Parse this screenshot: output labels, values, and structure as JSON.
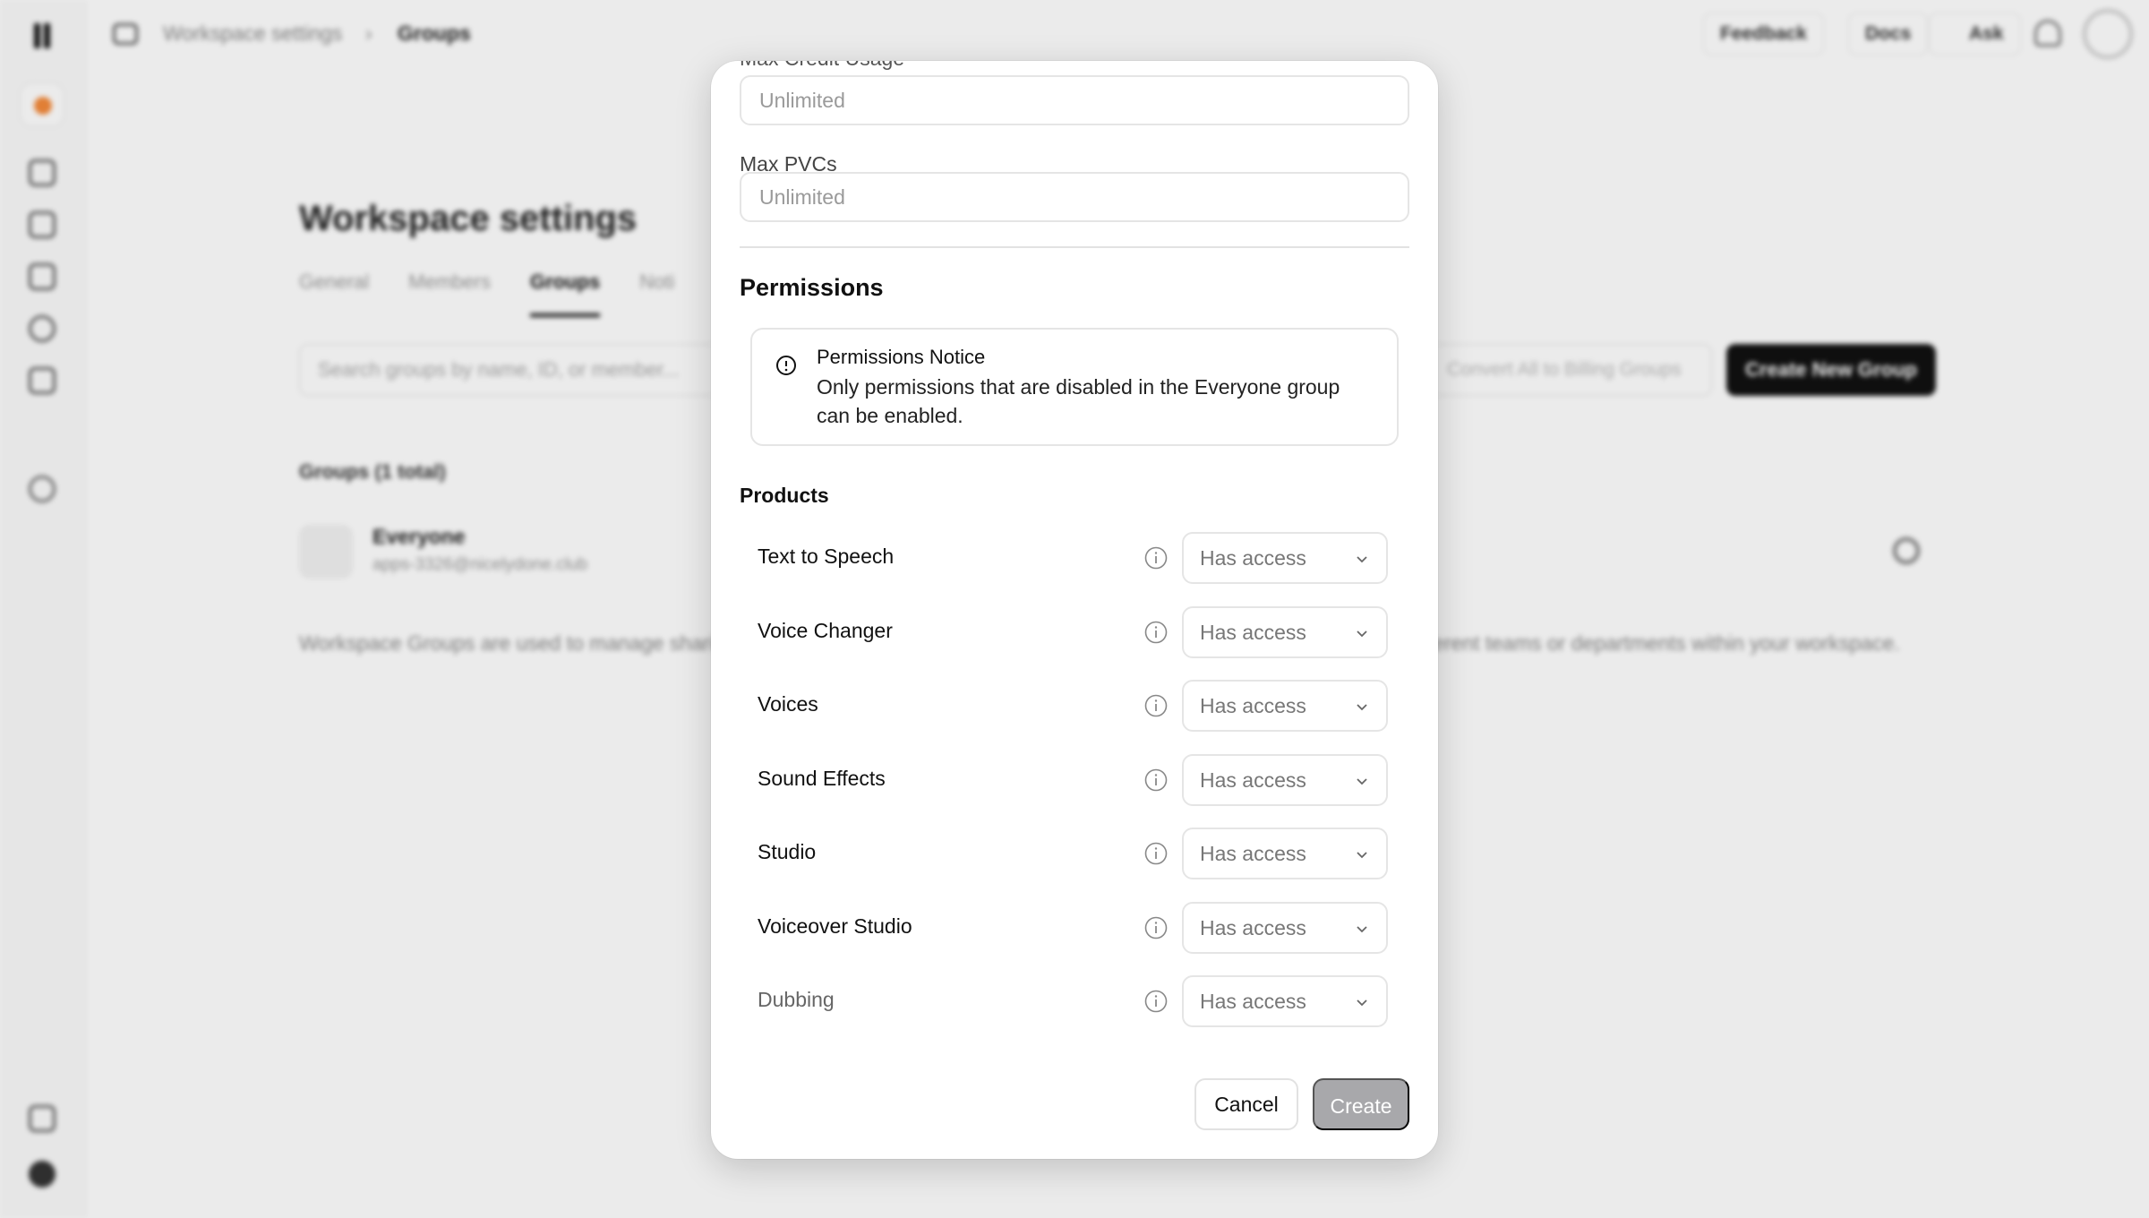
{
  "background": {
    "breadcrumb": {
      "parent": "Workspace settings",
      "separator": "›",
      "current": "Groups"
    },
    "topbar": {
      "feedback": "Feedback",
      "docs": "Docs",
      "ask": "Ask"
    },
    "page_title": "Workspace settings",
    "tabs": [
      {
        "label": "General"
      },
      {
        "label": "Members"
      },
      {
        "label": "Groups"
      },
      {
        "label": "Noti"
      }
    ],
    "search_placeholder": "Search groups by name, ID, or member...",
    "convert_label": "Convert All to Billing Groups",
    "create_group_label": "Create New Group",
    "groups_count": "Groups (1 total)",
    "group": {
      "name": "Everyone",
      "email": "apps-3326@nicelydone.club"
    },
    "description": "Workspace Groups are used to manage sharing and billing across your workspace. Use them to manage permissions for different teams or departments within your workspace."
  },
  "modal": {
    "max_credit_label": "Max Credit Usage",
    "max_credit_placeholder": "Unlimited",
    "max_pvcs_label": "Max PVCs",
    "max_pvcs_placeholder": "Unlimited",
    "permissions_heading": "Permissions",
    "notice": {
      "title": "Permissions Notice",
      "body": "Only permissions that are disabled in the Everyone group can be enabled."
    },
    "products_heading": "Products",
    "products": [
      {
        "name": "Text to Speech",
        "access": "Has access"
      },
      {
        "name": "Voice Changer",
        "access": "Has access"
      },
      {
        "name": "Voices",
        "access": "Has access"
      },
      {
        "name": "Sound Effects",
        "access": "Has access"
      },
      {
        "name": "Studio",
        "access": "Has access"
      },
      {
        "name": "Voiceover Studio",
        "access": "Has access"
      },
      {
        "name": "Dubbing",
        "access": "Has access"
      }
    ],
    "cancel_label": "Cancel",
    "create_label": "Create"
  }
}
